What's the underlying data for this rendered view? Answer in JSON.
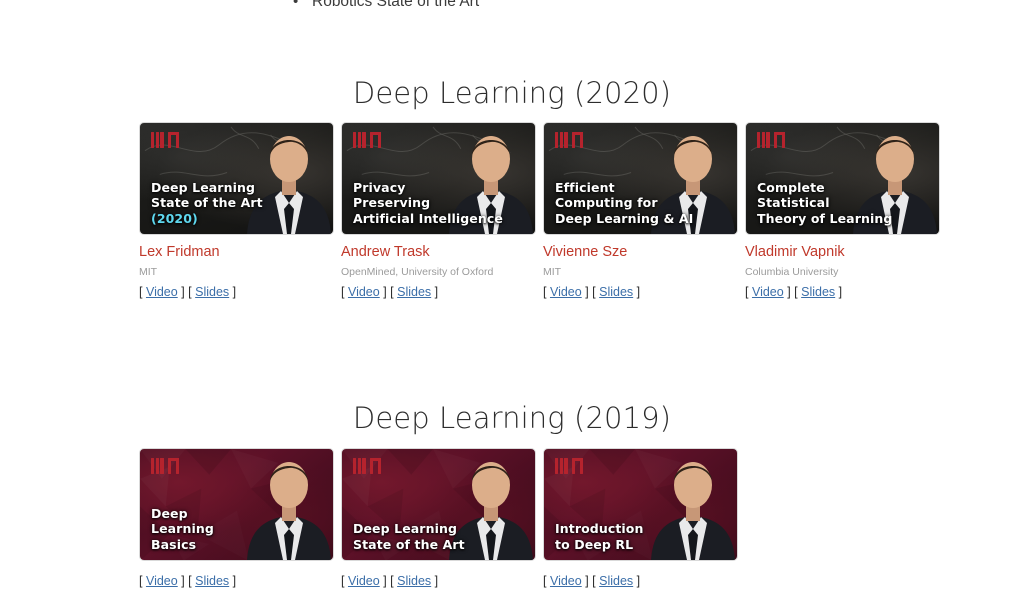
{
  "top_list": {
    "items": [
      {
        "label": "Robotics State of the Art"
      }
    ]
  },
  "sections": [
    {
      "id": "dl2020",
      "heading": "Deep Learning (2020)",
      "cards": [
        {
          "thumb_style": "chalk",
          "logo": "mit-logo",
          "title_lines": [
            "Deep Learning",
            "State of the Art"
          ],
          "title_accent": "(2020)",
          "speaker": "Lex Fridman",
          "affiliation": "MIT",
          "links": [
            {
              "label": "Video"
            },
            {
              "label": "Slides"
            }
          ]
        },
        {
          "thumb_style": "chalk",
          "logo": "mit-logo",
          "title_lines": [
            "Privacy",
            "Preserving",
            "Artificial Intelligence"
          ],
          "title_accent": "",
          "speaker": "Andrew Trask",
          "affiliation": "OpenMined, University of Oxford",
          "links": [
            {
              "label": "Video"
            },
            {
              "label": "Slides"
            }
          ]
        },
        {
          "thumb_style": "chalk",
          "logo": "mit-logo",
          "title_lines": [
            "Efficient",
            "Computing for",
            "Deep Learning & AI"
          ],
          "title_accent": "",
          "speaker": "Vivienne Sze",
          "affiliation": "MIT",
          "links": [
            {
              "label": "Video"
            },
            {
              "label": "Slides"
            }
          ]
        },
        {
          "thumb_style": "chalk",
          "logo": "mit-logo",
          "title_lines": [
            "Complete",
            "Statistical",
            "Theory of Learning"
          ],
          "title_accent": "",
          "speaker": "Vladimir Vapnik",
          "affiliation": "Columbia University",
          "links": [
            {
              "label": "Video"
            },
            {
              "label": "Slides"
            }
          ]
        }
      ]
    },
    {
      "id": "dl2019",
      "heading": "Deep Learning (2019)",
      "cards": [
        {
          "thumb_style": "maroon",
          "logo": "mit-logo",
          "title_lines": [
            "Deep",
            "Learning",
            "Basics"
          ],
          "title_accent": "",
          "speaker": "",
          "affiliation": "",
          "links": [
            {
              "label": "Video"
            },
            {
              "label": "Slides"
            }
          ]
        },
        {
          "thumb_style": "maroon",
          "logo": "mit-logo",
          "title_lines": [
            "Deep Learning",
            "State of the Art"
          ],
          "title_accent": "",
          "speaker": "",
          "affiliation": "",
          "links": [
            {
              "label": "Video"
            },
            {
              "label": "Slides"
            }
          ]
        },
        {
          "thumb_style": "maroon",
          "logo": "mit-logo",
          "title_lines": [
            "Introduction",
            "to Deep RL"
          ],
          "title_accent": "",
          "speaker": "",
          "affiliation": "",
          "links": [
            {
              "label": "Video"
            },
            {
              "label": "Slides"
            }
          ]
        }
      ]
    }
  ],
  "colors": {
    "speaker_name": "#c0392b",
    "link": "#3b6ea8",
    "affiliation": "#9b9b9b",
    "mit_red": "#b5232d",
    "accent_cyan": "#5fd8ef",
    "heading": "#2d2d2d"
  },
  "link_brackets": {
    "open": "[",
    "close": "]"
  }
}
